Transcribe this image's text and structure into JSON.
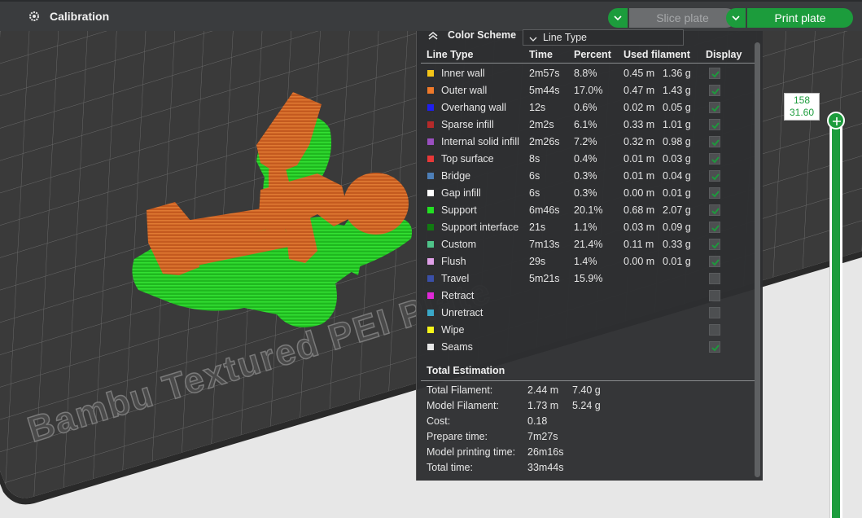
{
  "topbar": {
    "tab_title": "Calibration",
    "slice_label": "Slice plate",
    "print_label": "Print plate"
  },
  "scene": {
    "plate_text": "Bambu Textured PEI Plate"
  },
  "legend": {
    "scheme_label": "Color Scheme",
    "scheme_value": "Line Type",
    "headers": {
      "type": "Line Type",
      "time": "Time",
      "percent": "Percent",
      "used": "Used filament",
      "display": "Display"
    },
    "rows": [
      {
        "name": "Inner wall",
        "color": "#f5c518",
        "time": "2m57s",
        "pct": "8.8%",
        "len": "0.45 m",
        "wt": "1.36 g",
        "display": true
      },
      {
        "name": "Outer wall",
        "color": "#f07a2a",
        "time": "5m44s",
        "pct": "17.0%",
        "len": "0.47 m",
        "wt": "1.43 g",
        "display": true
      },
      {
        "name": "Overhang wall",
        "color": "#1f1ff0",
        "time": "12s",
        "pct": "0.6%",
        "len": "0.02 m",
        "wt": "0.05 g",
        "display": true
      },
      {
        "name": "Sparse infill",
        "color": "#b52a2a",
        "time": "2m2s",
        "pct": "6.1%",
        "len": "0.33 m",
        "wt": "1.01 g",
        "display": true
      },
      {
        "name": "Internal solid infill",
        "color": "#9a4fc0",
        "time": "2m26s",
        "pct": "7.2%",
        "len": "0.32 m",
        "wt": "0.98 g",
        "display": true
      },
      {
        "name": "Top surface",
        "color": "#e83838",
        "time": "8s",
        "pct": "0.4%",
        "len": "0.01 m",
        "wt": "0.03 g",
        "display": true
      },
      {
        "name": "Bridge",
        "color": "#4d7fb8",
        "time": "6s",
        "pct": "0.3%",
        "len": "0.01 m",
        "wt": "0.04 g",
        "display": true
      },
      {
        "name": "Gap infill",
        "color": "#ffffff",
        "time": "6s",
        "pct": "0.3%",
        "len": "0.00 m",
        "wt": "0.01 g",
        "display": true
      },
      {
        "name": "Support",
        "color": "#22e022",
        "time": "6m46s",
        "pct": "20.1%",
        "len": "0.68 m",
        "wt": "2.07 g",
        "display": true
      },
      {
        "name": "Support interface",
        "color": "#117a11",
        "time": "21s",
        "pct": "1.1%",
        "len": "0.03 m",
        "wt": "0.09 g",
        "display": true
      },
      {
        "name": "Custom",
        "color": "#4fc48a",
        "time": "7m13s",
        "pct": "21.4%",
        "len": "0.11 m",
        "wt": "0.33 g",
        "display": true
      },
      {
        "name": "Flush",
        "color": "#e0a0e8",
        "time": "29s",
        "pct": "1.4%",
        "len": "0.00 m",
        "wt": "0.01 g",
        "display": true
      },
      {
        "name": "Travel",
        "color": "#3a4fa8",
        "time": "5m21s",
        "pct": "15.9%",
        "len": "",
        "wt": "",
        "display": false
      },
      {
        "name": "Retract",
        "color": "#e028d8",
        "time": "",
        "pct": "",
        "len": "",
        "wt": "",
        "display": false
      },
      {
        "name": "Unretract",
        "color": "#3aa8c8",
        "time": "",
        "pct": "",
        "len": "",
        "wt": "",
        "display": false
      },
      {
        "name": "Wipe",
        "color": "#f5f51a",
        "time": "",
        "pct": "",
        "len": "",
        "wt": "",
        "display": false
      },
      {
        "name": "Seams",
        "color": "#e8e8e8",
        "time": "",
        "pct": "",
        "len": "",
        "wt": "",
        "display": true
      }
    ],
    "total_title": "Total Estimation",
    "totals": [
      {
        "label": "Total Filament:",
        "v1": "2.44 m",
        "v2": "7.40 g"
      },
      {
        "label": "Model Filament:",
        "v1": "1.73 m",
        "v2": "5.24 g"
      },
      {
        "label": "Cost:",
        "v1": "0.18",
        "v2": ""
      },
      {
        "label": "Prepare time:",
        "v1": "7m27s",
        "v2": ""
      },
      {
        "label": "Model printing time:",
        "v1": "26m16s",
        "v2": ""
      },
      {
        "label": "Total time:",
        "v1": "33m44s",
        "v2": ""
      }
    ]
  },
  "layer_slider": {
    "layer": "158",
    "height": "31.60"
  },
  "colors": {
    "accent": "#1c9c3c",
    "model": "#c8561e",
    "support": "#22cc22",
    "panel": "#2e2f31",
    "plate": "#3a3a3a"
  }
}
